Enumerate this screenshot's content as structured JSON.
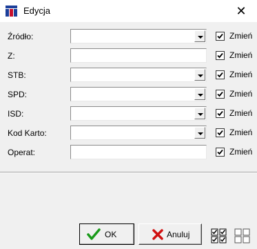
{
  "window": {
    "title": "Edycja",
    "close_glyph": "✕"
  },
  "rows": [
    {
      "label": "Źródło:",
      "type": "combo",
      "value": "",
      "check_label": "Zmień",
      "checked": true
    },
    {
      "label": "Z:",
      "type": "edit",
      "value": "",
      "check_label": "Zmień",
      "checked": true
    },
    {
      "label": "STB:",
      "type": "combo",
      "value": "",
      "check_label": "Zmień",
      "checked": true
    },
    {
      "label": "SPD:",
      "type": "combo",
      "value": "",
      "check_label": "Zmień",
      "checked": true
    },
    {
      "label": "ISD:",
      "type": "combo",
      "value": "",
      "check_label": "Zmień",
      "checked": true
    },
    {
      "label": "Kod Karto:",
      "type": "combo",
      "value": "",
      "check_label": "Zmień",
      "checked": true
    },
    {
      "label": "Operat:",
      "type": "edit",
      "value": "",
      "check_label": "Zmień",
      "checked": true
    }
  ],
  "buttons": {
    "ok": "OK",
    "cancel": "Anuluj"
  },
  "icons": {
    "app": "app-logo-icon",
    "ok": "checkmark-icon",
    "cancel": "x-mark-icon",
    "select_all": "select-all-icon",
    "select_none": "select-none-icon"
  },
  "colors": {
    "accent_blue": "#1c3f9a",
    "accent_red": "#c8102e",
    "check_green": "#1a9a1a",
    "cross_red": "#d01010"
  }
}
